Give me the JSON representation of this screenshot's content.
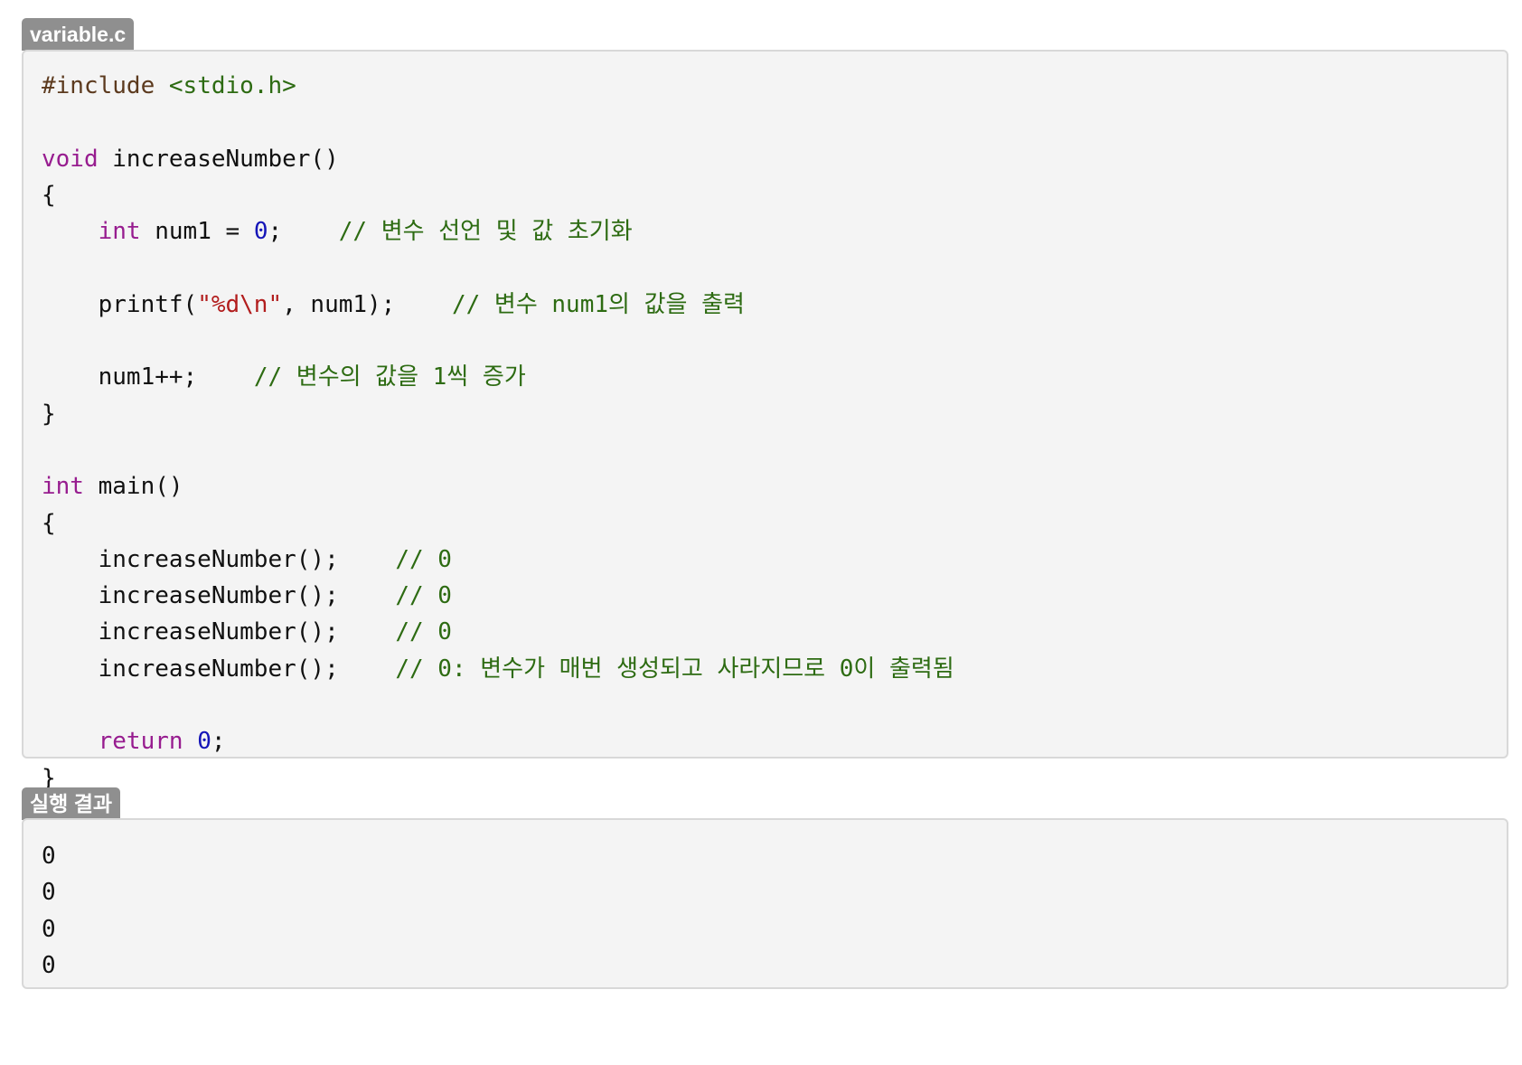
{
  "source_block": {
    "filename": "variable.c",
    "lines": [
      "#include <stdio.h>",
      "",
      "void increaseNumber()",
      "{",
      "    int num1 = 0;    // 변수 선언 및 값 초기화",
      "",
      "    printf(\"%d\\n\", num1);    // 변수 num1의 값을 출력",
      "",
      "    num1++;    // 변수의 값을 1씩 증가",
      "}",
      "",
      "int main()",
      "{",
      "    increaseNumber();    // 0",
      "    increaseNumber();    // 0",
      "    increaseNumber();    // 0",
      "    increaseNumber();    // 0: 변수가 매번 생성되고 사라지므로 0이 출력됨",
      "",
      "    return 0;",
      "}"
    ]
  },
  "output_block": {
    "label": "실행 결과",
    "lines": [
      "0",
      "0",
      "0",
      "0"
    ]
  },
  "syntax_colors": {
    "keyword": "#971c8f",
    "preprocessor": "#5c3a1e",
    "include_path": "#2d6b12",
    "number": "#1515b8",
    "string": "#b21d1d",
    "comment": "#2d6b12",
    "plain": "#111111",
    "tag_background": "#8f8f8f",
    "panel_background": "#f4f4f4"
  }
}
